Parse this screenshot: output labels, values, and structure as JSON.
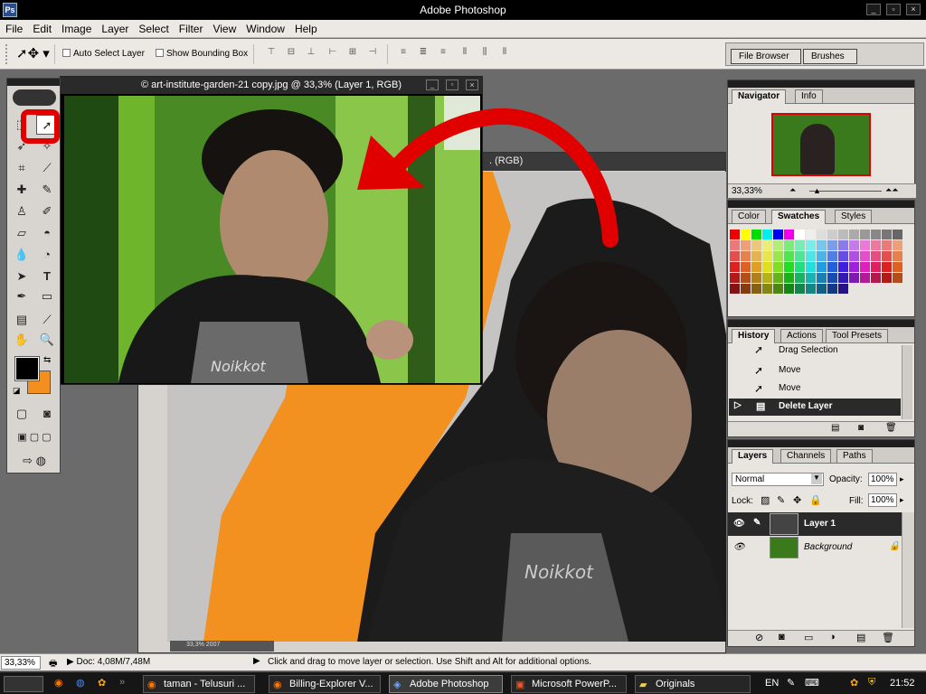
{
  "window": {
    "title": "Adobe Photoshop",
    "app_icon": "photoshop-icon"
  },
  "menu": [
    "File",
    "Edit",
    "Image",
    "Layer",
    "Select",
    "Filter",
    "View",
    "Window",
    "Help"
  ],
  "options": {
    "auto_select": "Auto Select Layer",
    "bounding_box": "Show Bounding Box",
    "file_browser": "File Browser",
    "brushes": "Brushes"
  },
  "docs": {
    "front_title": "© art-institute-garden-21 copy.jpg @ 33,3% (Layer 1, RGB)",
    "back_title_visible": ". (RGB)",
    "back_zoom_tag": "33,3% 2007"
  },
  "colors": {
    "foreground": "#000000",
    "background": "#f28f1e",
    "annotation": "#e00000"
  },
  "navigator": {
    "tabs": [
      "Navigator",
      "Info"
    ],
    "zoom": "33,33%"
  },
  "swatches": {
    "tabs": [
      "Color",
      "Swatches",
      "Styles"
    ]
  },
  "history": {
    "tabs": [
      "History",
      "Actions",
      "Tool Presets"
    ],
    "items": [
      "Drag Selection",
      "Move",
      "Move",
      "Delete Layer"
    ]
  },
  "layers": {
    "tabs": [
      "Layers",
      "Channels",
      "Paths"
    ],
    "blend": "Normal",
    "opacity_label": "Opacity:",
    "opacity": "100%",
    "lock_label": "Lock:",
    "fill_label": "Fill:",
    "fill": "100%",
    "rows": [
      "Layer 1",
      "Background"
    ]
  },
  "status": {
    "zoom": "33,33%",
    "doc": "Doc: 4,08M/7,48M",
    "hint": "Click and drag to move layer or selection.  Use Shift and Alt for additional options."
  },
  "taskbar": {
    "items": [
      "taman - Telusuri ...",
      "Billing-Explorer V...",
      "Adobe Photoshop",
      "Microsoft PowerP...",
      "Originals"
    ],
    "lang": "EN",
    "clock": "21:52"
  }
}
